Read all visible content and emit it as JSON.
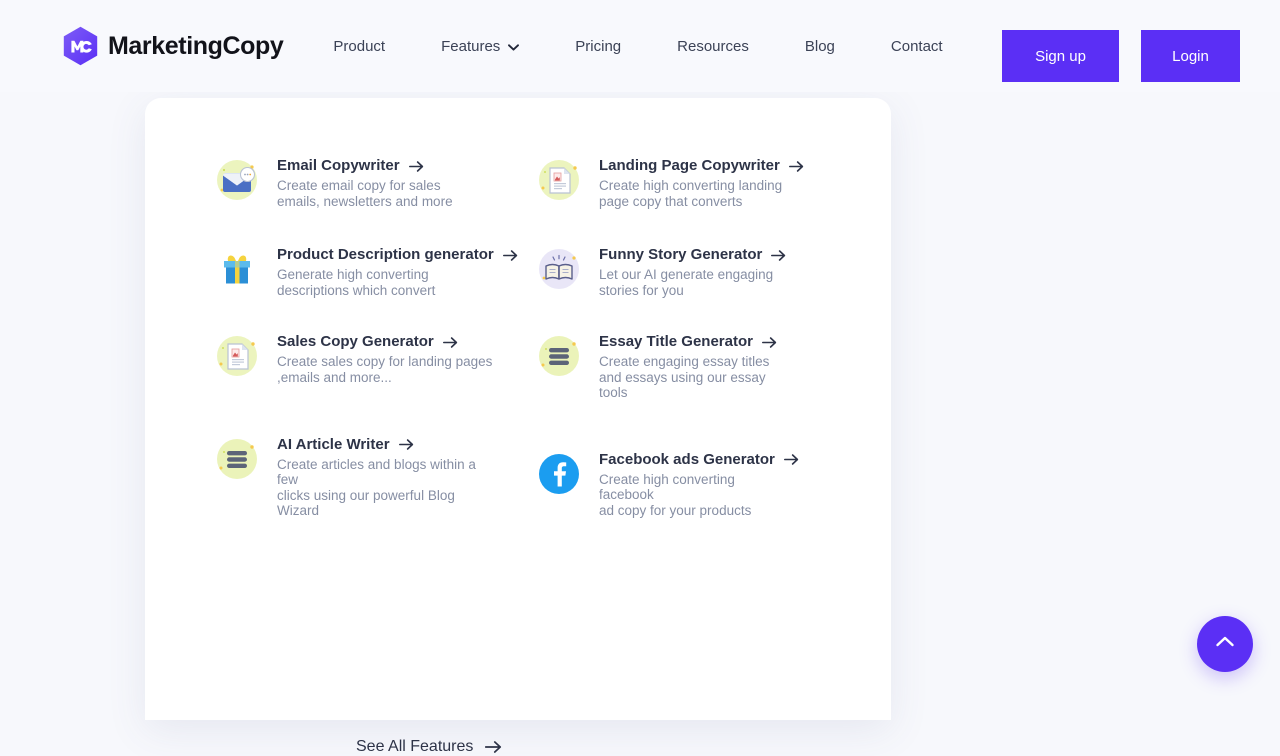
{
  "brand": {
    "name": "MarketingCopy",
    "logo_icon": "mc-hexagon-logo",
    "logo_color": "#6a3df0"
  },
  "nav": {
    "items": [
      {
        "label": "Product",
        "has_dropdown": false
      },
      {
        "label": "Features",
        "has_dropdown": true
      },
      {
        "label": "Pricing",
        "has_dropdown": false
      },
      {
        "label": "Resources",
        "has_dropdown": false
      },
      {
        "label": "Blog",
        "has_dropdown": false
      },
      {
        "label": "Contact",
        "has_dropdown": false
      }
    ],
    "dropdown_icon": "chevron-down-icon"
  },
  "auth": {
    "signup_label": "Sign up",
    "login_label": "Login",
    "button_color": "#5b2ff5"
  },
  "dropdown": {
    "open_for": "Features",
    "items": [
      {
        "title": "Email Copywriter",
        "desc": "Create email copy for sales\nemails, newsletters and more",
        "icon": "envelope-icon"
      },
      {
        "title": "Landing Page Copywriter",
        "desc": "Create high converting landing\npage copy that converts",
        "icon": "document-page-icon"
      },
      {
        "title": "Product Description generator",
        "desc": "Generate high converting\ndescriptions which convert",
        "icon": "gift-box-icon"
      },
      {
        "title": "Funny Story Generator",
        "desc": "Let our AI generate engaging\nstories for you",
        "icon": "open-book-icon"
      },
      {
        "title": "Sales Copy Generator",
        "desc": "Create sales copy for landing pages\n,emails and more...",
        "icon": "document-page-icon"
      },
      {
        "title": "Essay Title Generator",
        "desc": "Create engaging essay titles\nand essays using our essay\ntools",
        "icon": "text-lines-icon"
      },
      {
        "title": "AI Article Writer",
        "desc": "Create articles and blogs within a\nfew\nclicks using our powerful Blog\nWizard",
        "icon": "text-lines-icon"
      },
      {
        "title": "Facebook ads Generator",
        "desc": "Create high converting\nfacebook\nad copy for your products",
        "icon": "facebook-icon"
      }
    ],
    "see_all_label": "See All Features",
    "arrow_icon": "arrow-right-icon"
  },
  "scroll_top": {
    "icon": "chevron-up-icon",
    "color": "#5b2ff5"
  }
}
